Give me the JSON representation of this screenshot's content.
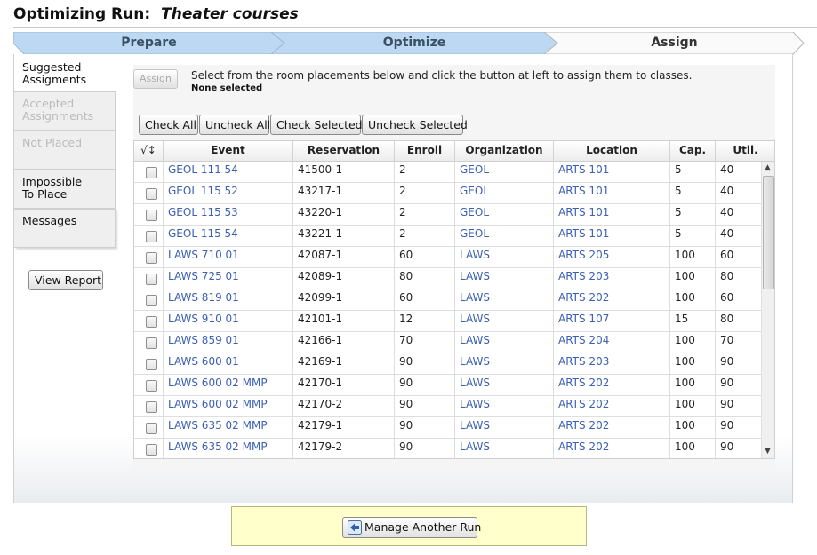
{
  "page": {
    "title_prefix": "Optimizing Run:",
    "run_name": "Theater courses"
  },
  "steps": [
    {
      "label": "Prepare"
    },
    {
      "label": "Optimize"
    },
    {
      "label": "Assign"
    }
  ],
  "sidebar": {
    "tabs": [
      {
        "label": "Suggested\nAssigments",
        "state": "active"
      },
      {
        "label": "Accepted\nAssignments",
        "state": "disabled"
      },
      {
        "label": "Not Placed",
        "state": "disabled"
      },
      {
        "label": "Impossible\nTo Place",
        "state": "normal"
      },
      {
        "label": "Messages",
        "state": "normal"
      }
    ],
    "view_report_label": "View Report"
  },
  "assign": {
    "button_label": "Assign",
    "instruction": "Select from the room placements below and click the button at left to assign them to classes.",
    "status": "None selected"
  },
  "toolbar": {
    "check_all": "Check All",
    "uncheck_all": "Uncheck All",
    "check_selected": "Check Selected",
    "uncheck_selected": "Uncheck Selected"
  },
  "table": {
    "sort_header": "√↕",
    "columns": [
      "Event",
      "Reservation",
      "Enroll",
      "Organization",
      "Location",
      "Cap.",
      "Util."
    ],
    "rows": [
      [
        "GEOL 111 54",
        "41500-1",
        "2",
        "GEOL",
        "ARTS 101",
        "5",
        "40"
      ],
      [
        "GEOL 115 52",
        "43217-1",
        "2",
        "GEOL",
        "ARTS 101",
        "5",
        "40"
      ],
      [
        "GEOL 115 53",
        "43220-1",
        "2",
        "GEOL",
        "ARTS 101",
        "5",
        "40"
      ],
      [
        "GEOL 115 54",
        "43221-1",
        "2",
        "GEOL",
        "ARTS 101",
        "5",
        "40"
      ],
      [
        "LAWS 710 01",
        "42087-1",
        "60",
        "LAWS",
        "ARTS 205",
        "100",
        "60"
      ],
      [
        "LAWS 725 01",
        "42089-1",
        "80",
        "LAWS",
        "ARTS 203",
        "100",
        "80"
      ],
      [
        "LAWS 819 01",
        "42099-1",
        "60",
        "LAWS",
        "ARTS 202",
        "100",
        "60"
      ],
      [
        "LAWS 910 01",
        "42101-1",
        "12",
        "LAWS",
        "ARTS 107",
        "15",
        "80"
      ],
      [
        "LAWS 859 01",
        "42166-1",
        "70",
        "LAWS",
        "ARTS 204",
        "100",
        "70"
      ],
      [
        "LAWS 600 01",
        "42169-1",
        "90",
        "LAWS",
        "ARTS 203",
        "100",
        "90"
      ],
      [
        "LAWS 600 02 MMP",
        "42170-1",
        "90",
        "LAWS",
        "ARTS 202",
        "100",
        "90"
      ],
      [
        "LAWS 600 02 MMP",
        "42170-2",
        "90",
        "LAWS",
        "ARTS 202",
        "100",
        "90"
      ],
      [
        "LAWS 635 02 MMP",
        "42179-1",
        "90",
        "LAWS",
        "ARTS 202",
        "100",
        "90"
      ],
      [
        "LAWS 635 02 MMP",
        "42179-2",
        "90",
        "LAWS",
        "ARTS 202",
        "100",
        "90"
      ]
    ]
  },
  "footer": {
    "manage_label": "Manage Another Run"
  },
  "colors": {
    "link": "#3a5fb5",
    "step_done": "#bcd8f2",
    "footer_bg": "#ffffcc"
  }
}
